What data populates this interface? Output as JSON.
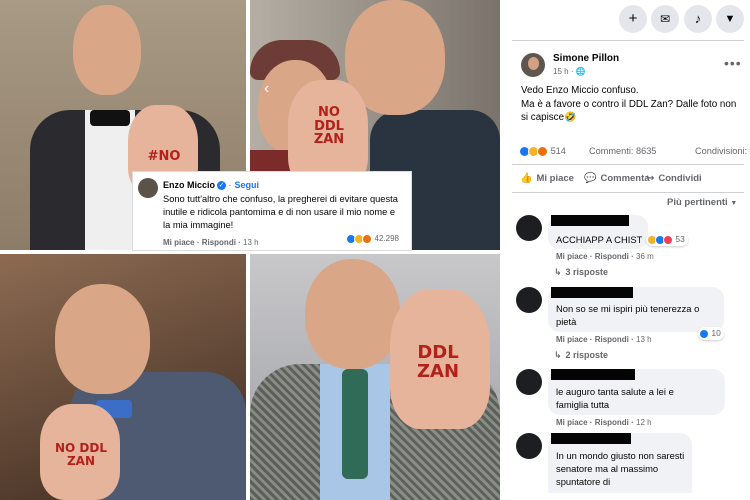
{
  "embed": {
    "author": "Enzo Miccio",
    "follow": "Segui",
    "text": "Sono tutt'altro che confuso, la pregherei di evitare questa inutile e ridicola pantomima e di non usare il mio nome e la mia immagine!",
    "like": "Mi piace",
    "reply": "Rispondi",
    "time": "13 h",
    "reaction_count": "42.298"
  },
  "photos": {
    "p1_hand": "#NO",
    "p2_hand": "NO DDL ZAN",
    "p3_hand": "NO DDL ZAN",
    "p4_hand": "DDL ZAN"
  },
  "topbar": {
    "icons": [
      "plus-icon",
      "messenger-icon",
      "notifications-icon",
      "account-menu-icon"
    ]
  },
  "post": {
    "author": "Simone Pillon",
    "time": "15 h",
    "line1": "Vedo Enzo Miccio confuso.",
    "line2": "Ma è a favore o contro il DDL Zan? Dalle foto non si capisce🤣",
    "reactions": "514",
    "comments": "Commenti: 8635",
    "shares": "Condivisioni: 537",
    "like": "Mi piace",
    "comment": "Commenta",
    "share": "Condividi",
    "sort": "Più pertinenti"
  },
  "comments": [
    {
      "text": "ACCHIAPP A CHIST",
      "reaction_count": "53",
      "like": "Mi piace",
      "reply": "Rispondi",
      "time": "36 m",
      "replies": "3 risposte"
    },
    {
      "text": "Non so se mi ispiri più tenerezza o pietà",
      "reaction_count": "10",
      "like": "Mi piace",
      "reply": "Rispondi",
      "time": "13 h",
      "replies": "2 risposte"
    },
    {
      "text": "le auguro tanta salute a lei e famiglia tutta",
      "like": "Mi piace",
      "reply": "Rispondi",
      "time": "12 h"
    },
    {
      "text": "In un mondo giusto non saresti senatore ma al massimo spuntatore di"
    }
  ],
  "colors": {
    "accent": "#1877f2",
    "secondary_text": "#65676b",
    "bubble": "#f0f2f5"
  }
}
